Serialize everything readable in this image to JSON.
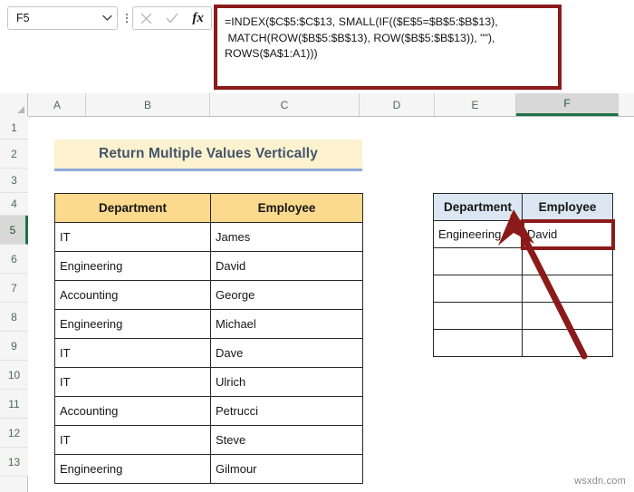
{
  "formula_bar": {
    "name_box_value": "F5",
    "name_box_icon": "chevron-down-icon",
    "cancel_icon": "cancel-x-icon",
    "confirm_icon": "confirm-check-icon",
    "function_icon": "fx-insert-function-icon",
    "formula": "=INDEX($C$5:$C$13, SMALL(IF(($E$5=$B$5:$B$13),\n MATCH(ROW($B$5:$B$13), ROW($B$5:$B$13)), \"\"),\nROWS($A$1:A1)))",
    "highlight_color": "#8B1A1A"
  },
  "grid": {
    "column_headers": [
      "A",
      "B",
      "C",
      "D",
      "E",
      "F"
    ],
    "selected_column": "F",
    "row_headers": [
      "1",
      "2",
      "3",
      "4",
      "5",
      "6",
      "7",
      "8",
      "9",
      "10",
      "11",
      "12",
      "13"
    ],
    "selected_row": "5",
    "selection_accent": "#1E7145"
  },
  "title_banner": {
    "text": "Return Multiple Values Vertically",
    "background": "#FDF2CF",
    "text_color": "#44546A",
    "underline_color": "#8FAADC"
  },
  "source_table": {
    "header_background": "#FBD98D",
    "headers": [
      "Department",
      "Employee"
    ],
    "rows": [
      [
        "IT",
        "James"
      ],
      [
        "Engineering",
        "David"
      ],
      [
        "Accounting",
        "George"
      ],
      [
        "Engineering",
        "Michael"
      ],
      [
        "IT",
        "Dave"
      ],
      [
        "IT",
        "Ulrich"
      ],
      [
        "Accounting",
        "Petrucci"
      ],
      [
        "IT",
        "Steve"
      ],
      [
        "Engineering",
        "Gilmour"
      ]
    ]
  },
  "result_table": {
    "header_background": "#DCE6F2",
    "headers": [
      "Department",
      "Employee"
    ],
    "rows": [
      [
        "Engineering",
        "David"
      ],
      [
        "",
        ""
      ],
      [
        "",
        ""
      ],
      [
        "",
        ""
      ],
      [
        "",
        ""
      ]
    ]
  },
  "annotation": {
    "arrow_color": "#8B1A1A",
    "arrow_name": "callout-arrow-to-formula-bar"
  },
  "watermark": {
    "text": "wsxdn.com"
  }
}
